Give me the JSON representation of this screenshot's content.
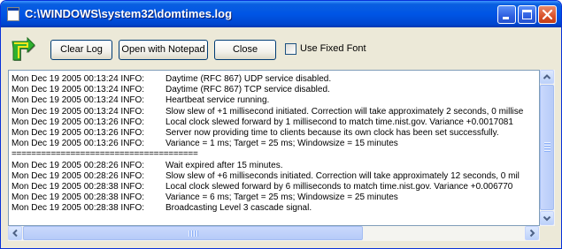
{
  "window": {
    "title": "C:\\WINDOWS\\system32\\domtimes.log",
    "app_icon": "log-file-icon",
    "controls": [
      "minimize-icon",
      "maximize-icon",
      "close-icon"
    ]
  },
  "toolbar": {
    "icon": "green-arrow-icon",
    "clear_label": "Clear Log",
    "notepad_label": "Open with Notepad",
    "close_label": "Close",
    "fixed_font_label": "Use Fixed Font",
    "fixed_font_checked": false
  },
  "log": {
    "lines": [
      {
        "ts": "Mon Dec 19 2005 00:13:24 INFO:",
        "msg": "Daytime (RFC 867) UDP service disabled."
      },
      {
        "ts": "Mon Dec 19 2005 00:13:24 INFO:",
        "msg": "Daytime (RFC 867) TCP service disabled."
      },
      {
        "ts": "Mon Dec 19 2005 00:13:24 INFO:",
        "msg": "Heartbeat service running."
      },
      {
        "ts": "Mon Dec 19 2005 00:13:24 INFO:",
        "msg": "Slow slew of +1 millisecond initiated. Correction will take approximately 2 seconds, 0 millise"
      },
      {
        "ts": "Mon Dec 19 2005 00:13:26 INFO:",
        "msg": "Local clock slewed forward by 1 millisecond to match time.nist.gov. Variance +0.0017081"
      },
      {
        "ts": "Mon Dec 19 2005 00:13:26 INFO:",
        "msg": "Server now providing time to clients because its own clock has been set successfully."
      },
      {
        "ts": "Mon Dec 19 2005 00:13:26 INFO:",
        "msg": "Variance = 1 ms; Target = 25 ms; Windowsize = 15 minutes"
      },
      {
        "separator": "======================================"
      },
      {
        "ts": "Mon Dec 19 2005 00:28:26 INFO:",
        "msg": "Wait expired after 15 minutes."
      },
      {
        "ts": "Mon Dec 19 2005 00:28:26 INFO:",
        "msg": "Slow slew of +6 milliseconds initiated. Correction will take approximately 12 seconds, 0 mil"
      },
      {
        "ts": "Mon Dec 19 2005 00:28:38 INFO:",
        "msg": "Local clock slewed forward by 6 milliseconds to match time.nist.gov. Variance +0.006770"
      },
      {
        "ts": "Mon Dec 19 2005 00:28:38 INFO:",
        "msg": "Variance = 6 ms; Target = 25 ms; Windowsize = 25 minutes"
      },
      {
        "ts": "Mon Dec 19 2005 00:28:38 INFO:",
        "msg": "Broadcasting Level 3 cascade signal."
      }
    ]
  },
  "scrollbars": {
    "vertical_icons": [
      "scroll-up-arrow-icon",
      "scroll-down-arrow-icon"
    ],
    "horizontal_icons": [
      "scroll-left-arrow-icon",
      "scroll-right-arrow-icon"
    ]
  },
  "colors": {
    "titlebar": "#0055e5",
    "window_bg": "#ece9d8",
    "button_border": "#003c74",
    "log_bg": "#ffffff"
  }
}
